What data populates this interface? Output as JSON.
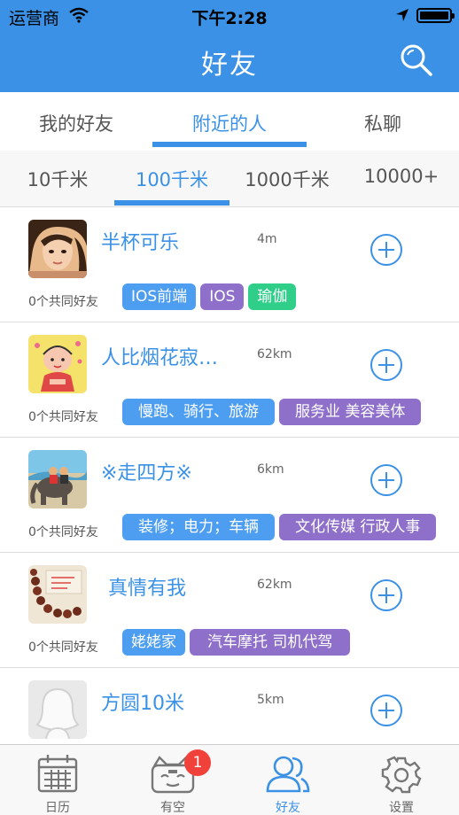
{
  "status": {
    "carrier": "运营商",
    "time": "下午2:28"
  },
  "nav": {
    "title": "好友",
    "search_icon": "search-icon"
  },
  "tabs_primary": [
    {
      "label": "我的好友",
      "active": false
    },
    {
      "label": "附近的人",
      "active": true
    },
    {
      "label": "私聊",
      "active": false
    }
  ],
  "tabs_distance": [
    {
      "label": "10千米",
      "active": false
    },
    {
      "label": "100千米",
      "active": true
    },
    {
      "label": "1000千米",
      "active": false
    },
    {
      "label": "10000+",
      "active": false
    }
  ],
  "colors": {
    "accent": "#3a91e6",
    "tag_blue": "#4d9ef0",
    "tag_purple": "#8e6fc9",
    "tag_green": "#2fcf8a",
    "badge": "#f0423a"
  },
  "people": [
    {
      "name": "半杯可乐",
      "distance": "4m",
      "mutual": "0个共同好友",
      "avatar": "girl-photo",
      "tags": [
        {
          "text": "IOS前端",
          "color": "blue"
        },
        {
          "text": "IOS",
          "color": "purple"
        },
        {
          "text": "瑜伽",
          "color": "green"
        }
      ]
    },
    {
      "name": "人比烟花寂…",
      "distance": "62km",
      "mutual": "0个共同好友",
      "avatar": "cartoon-girl",
      "tags": [
        {
          "text": "慢跑、骑行、旅游",
          "color": "blue"
        },
        {
          "text": "服务业 美容美体",
          "color": "purple"
        }
      ]
    },
    {
      "name": "※走四方※",
      "distance": "6km",
      "mutual": "0个共同好友",
      "avatar": "elephant-photo",
      "tags": [
        {
          "text": "装修；电力；车辆",
          "color": "blue"
        },
        {
          "text": "文化传媒 行政人事",
          "color": "purple"
        }
      ]
    },
    {
      "name": "真情有我",
      "distance": "62km",
      "mutual": "0个共同好友",
      "avatar": "beads-photo",
      "tags": [
        {
          "text": "姥姥家",
          "color": "blue"
        },
        {
          "text": "汽车摩托 司机代驾",
          "color": "purple"
        }
      ]
    },
    {
      "name": "方圆10米",
      "distance": "5km",
      "mutual": "",
      "avatar": "default-silhouette",
      "tags": []
    }
  ],
  "tabbar": [
    {
      "label": "日历",
      "icon": "calendar-icon",
      "active": false
    },
    {
      "label": "有空",
      "icon": "cat-face-icon",
      "active": false,
      "badge": "1"
    },
    {
      "label": "好友",
      "icon": "friends-icon",
      "active": true
    },
    {
      "label": "设置",
      "icon": "gear-icon",
      "active": false
    }
  ]
}
